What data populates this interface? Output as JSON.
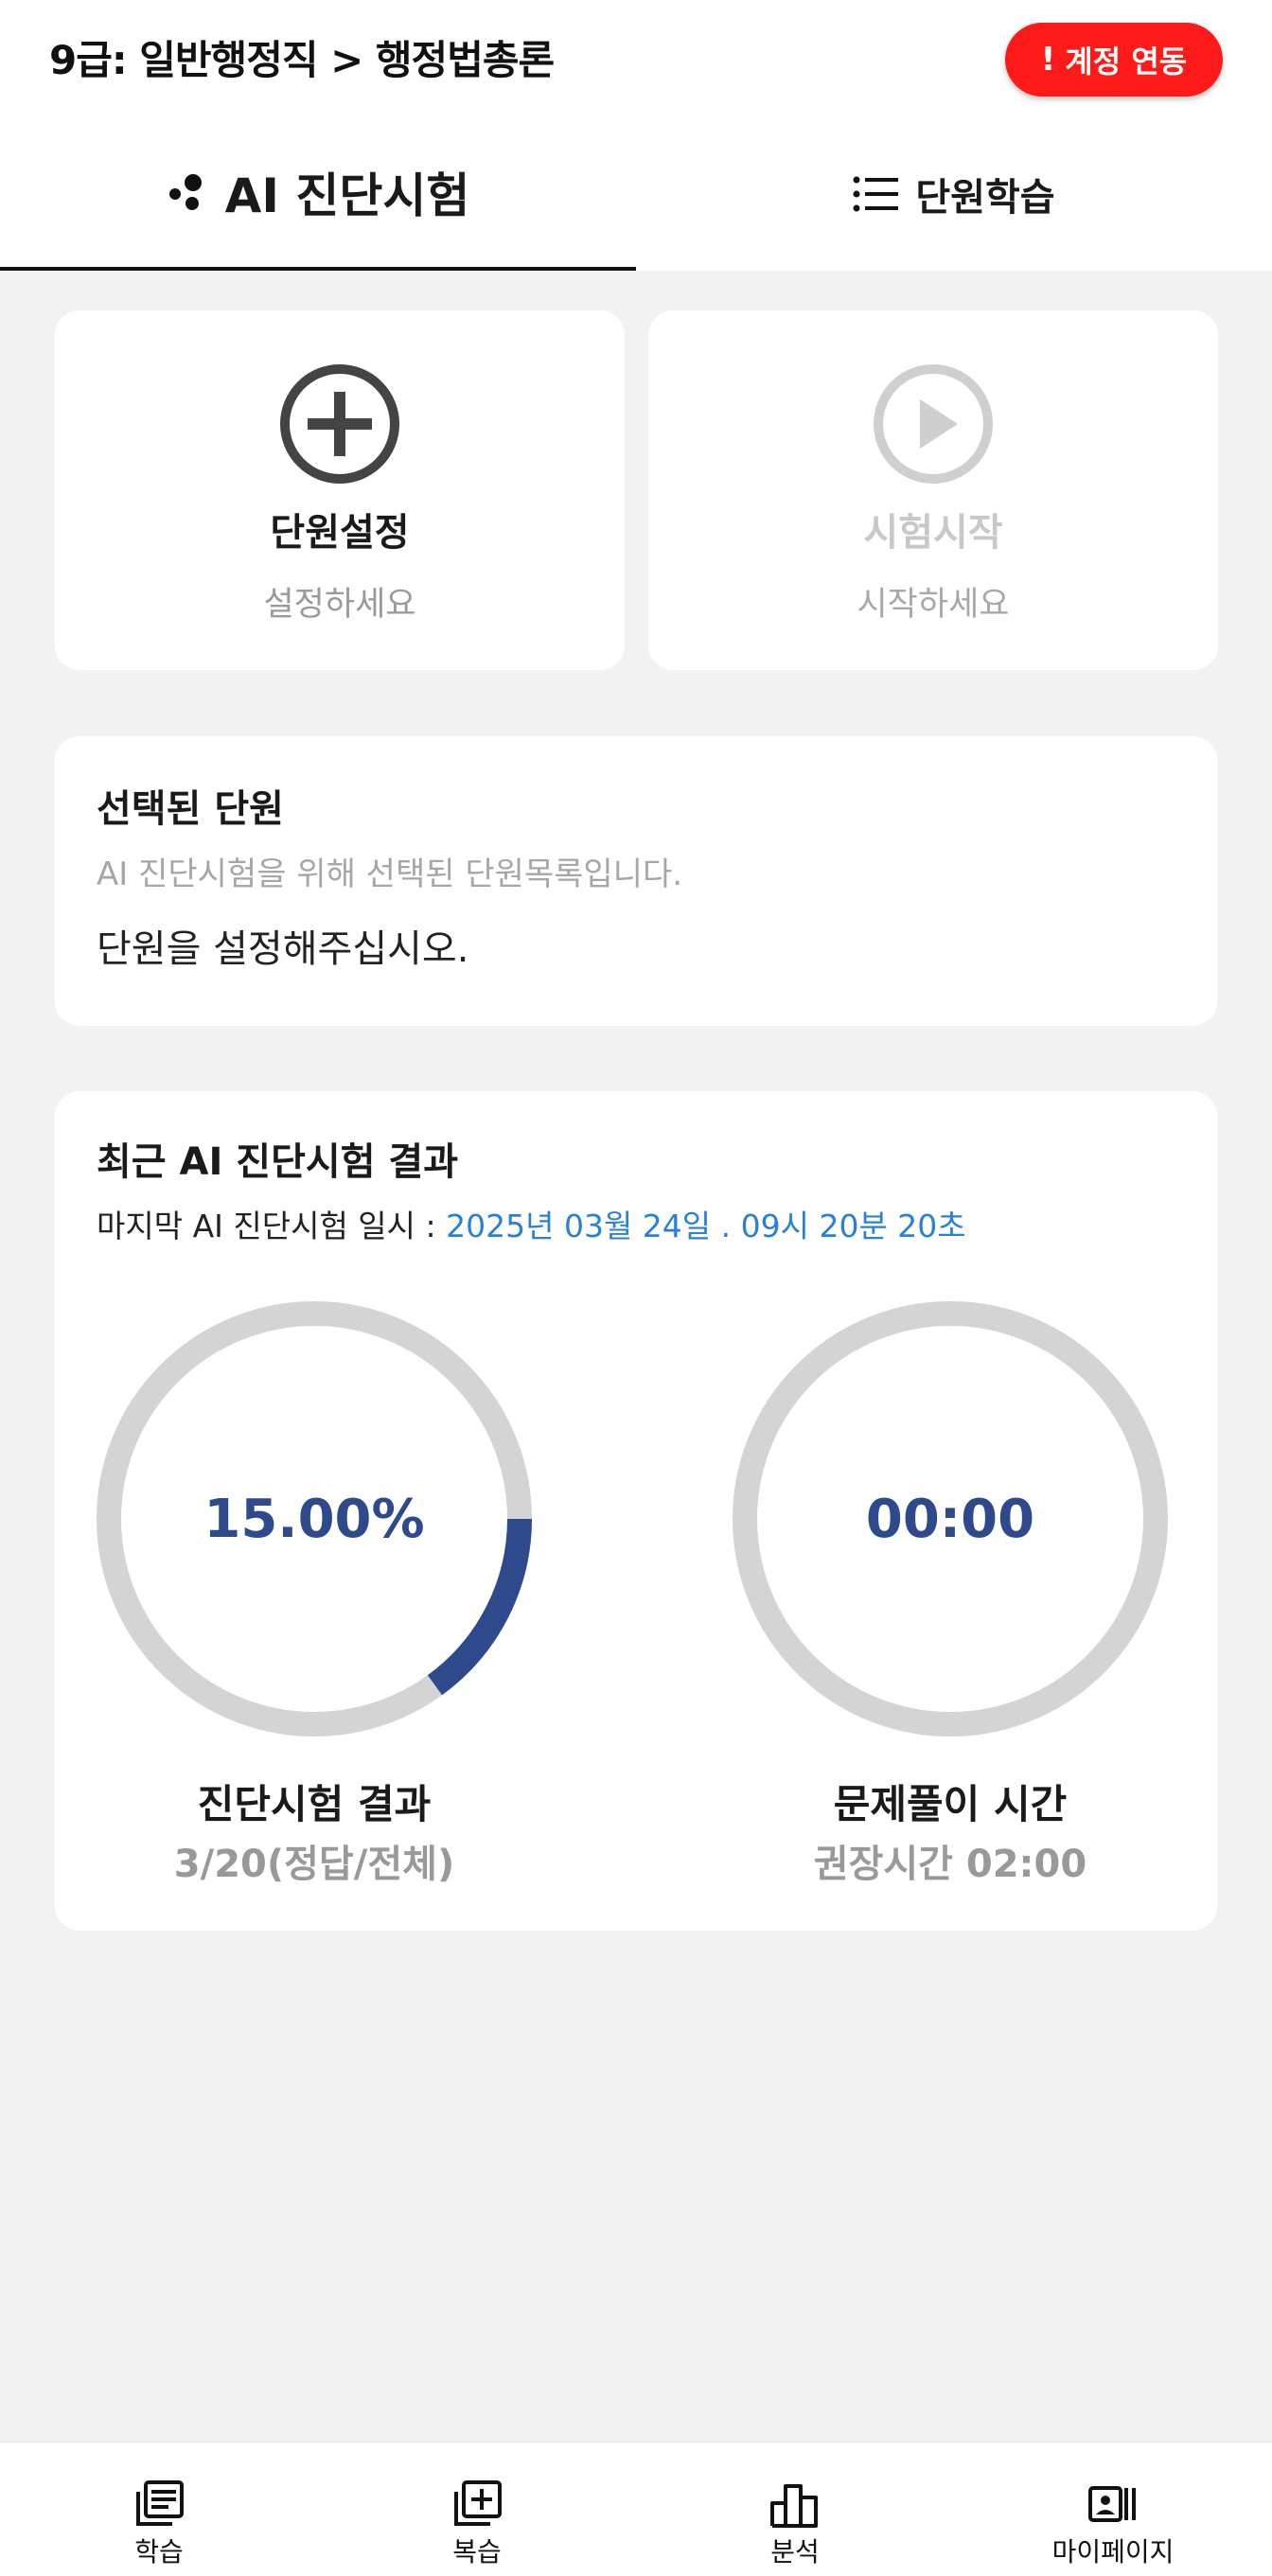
{
  "header": {
    "title": "9급: 일반행정직 > 행정법총론",
    "link_button": {
      "mark": "!",
      "label": "계정 연동",
      "color": "#ff1a1a"
    }
  },
  "tabs": [
    {
      "label": "AI 진단시험",
      "icon": "ai-dots-icon",
      "active": true
    },
    {
      "label": "단원학습",
      "icon": "list-icon",
      "active": false
    }
  ],
  "actions": {
    "unit_setting": {
      "title": "단원설정",
      "subtitle": "설정하세요",
      "icon": "plus-circle-icon"
    },
    "test_start": {
      "title": "시험시작",
      "subtitle": "시작하세요",
      "icon": "play-circle-icon",
      "disabled": true
    }
  },
  "selected_units": {
    "title": "선택된 단원",
    "description": "AI 진단시험을 위해 선택된 단원목록입니다.",
    "empty_message": "단원을 설정해주십시오."
  },
  "recent_result": {
    "title": "최근 AI 진단시험 결과",
    "date_label": "마지막 AI 진단시험 일시 : ",
    "date_value": "2025년 03월 24일 . 09시 20분 20초",
    "score": {
      "value_text": "15.00%",
      "fraction": 0.15,
      "label": "진단시험 결과",
      "sub": "3/20(정답/전체)"
    },
    "time": {
      "value_text": "00:00",
      "fraction": 0,
      "label": "문제풀이 시간",
      "sub": "권장시간 02:00"
    },
    "colors": {
      "track": "#d4d4d4",
      "progress": "#2e4a8c",
      "date": "#2a7fd6"
    }
  },
  "bottom_nav": [
    {
      "label": "학습",
      "icon": "book-icon"
    },
    {
      "label": "복습",
      "icon": "add-box-icon"
    },
    {
      "label": "분석",
      "icon": "bar-chart-icon"
    },
    {
      "label": "마이페이지",
      "icon": "profile-card-icon"
    }
  ]
}
